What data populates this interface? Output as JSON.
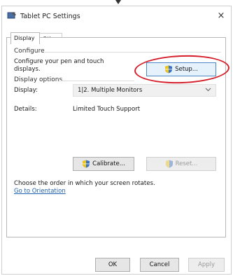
{
  "window": {
    "title": "Tablet PC Settings",
    "close_glyph": "×"
  },
  "tabs": [
    {
      "label": "Display"
    },
    {
      "label": "Other"
    }
  ],
  "configure": {
    "group_label": "Configure",
    "description_line1": "Configure your pen and touch",
    "description_line2": "displays.",
    "setup_button": "Setup..."
  },
  "display_options": {
    "group_label": "Display options",
    "display_label": "Display:",
    "display_value": "1|2. Multiple Monitors",
    "details_label": "Details:",
    "details_value": "Limited Touch Support",
    "calibrate_button": "Calibrate...",
    "reset_button": "Reset..."
  },
  "orientation": {
    "text": "Choose the order in which your screen rotates.",
    "link": "Go to Orientation"
  },
  "footer": {
    "ok": "OK",
    "cancel": "Cancel",
    "apply": "Apply"
  },
  "colors": {
    "highlight_circle": "#d41f2a",
    "link": "#1b5fae",
    "accent_border": "#4b87c7"
  },
  "icons": {
    "app": "tablet-pc-icon",
    "shield": "uac-shield-icon"
  }
}
